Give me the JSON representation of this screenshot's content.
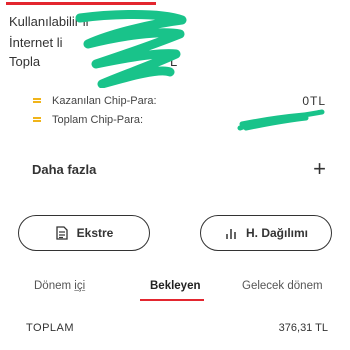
{
  "limit_card": {
    "line1": "Kullanılabilir li",
    "line2": "İnternet li",
    "line3": "Topla",
    "line3_suffix": "L",
    "accent_color": "#e3262f",
    "scribble_color": "#19c38a"
  },
  "chip": {
    "earned_label": "Kazanılan Chip-Para:",
    "earned_value": "0TL",
    "total_label": "Toplam Chip-Para:",
    "icon": "coin-stack-icon",
    "icon_color": "#f0b41a"
  },
  "more": {
    "label": "Daha fazla",
    "icon": "plus-icon"
  },
  "buttons": {
    "statement": "Ekstre",
    "statement_icon": "document-icon",
    "distribution": "H. Dağılımı",
    "distribution_icon": "bar-chart-icon"
  },
  "tabs": {
    "current_prefix": "Dönem ",
    "current_u": "içi",
    "pending": "Bekleyen",
    "next": "Gelecek dönem",
    "active": "pending",
    "active_color": "#e3262f"
  },
  "total": {
    "label": "TOPLAM",
    "value": "376,31 TL"
  }
}
